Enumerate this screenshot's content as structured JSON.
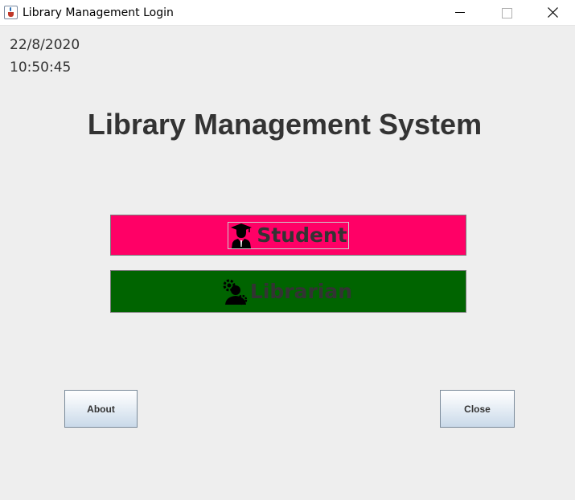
{
  "window": {
    "title": "Library Management Login",
    "icon": "java-icon",
    "controls": [
      "minimize-icon",
      "maximize-icon",
      "close-icon"
    ]
  },
  "clock": {
    "date": "22/8/2020",
    "time": "10:50:45"
  },
  "heading": "Library Management System",
  "roles": {
    "student": {
      "label": "Student",
      "icon": "graduate-icon",
      "color": "#ff0066"
    },
    "librarian": {
      "label": "Librarian",
      "icon": "librarian-gear-icon",
      "color": "#006400"
    }
  },
  "buttons": {
    "about": "About",
    "close": "Close"
  }
}
